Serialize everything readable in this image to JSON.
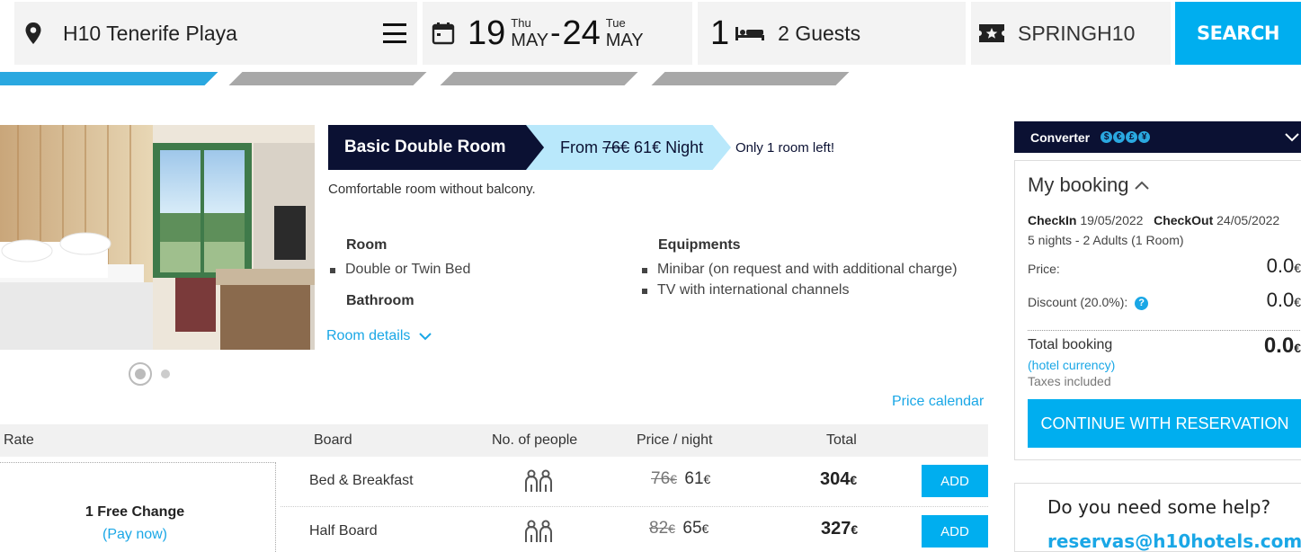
{
  "search_bar": {
    "hotel": "H10 Tenerife Playa",
    "checkin": {
      "day": "19",
      "weekday": "Thu",
      "month": "MAY"
    },
    "separator": "-",
    "checkout": {
      "day": "24",
      "weekday": "Tue",
      "month": "MAY"
    },
    "rooms": "1",
    "guests": "2 Guests",
    "promo_code": "SPRINGH10",
    "search_label": "SEARCH"
  },
  "steps": {
    "active_step": 1,
    "total_steps": 4
  },
  "room": {
    "title": "Basic Double Room",
    "price_prefix": "From",
    "old_price": "76€",
    "new_price": "61€",
    "price_suffix": "Night",
    "availability": "Only 1 room left!",
    "description": "Comfortable room without balcony.",
    "room_heading": "Room",
    "room_items": [
      "Double or Twin Bed"
    ],
    "bathroom_heading": "Bathroom",
    "equipment_heading": "Equipments",
    "equipment_items": [
      "Minibar (on request and with additional charge)",
      "TV with international channels"
    ],
    "details_link": "Room details",
    "photo_count": 2,
    "photo_active": 1
  },
  "price_calendar_link": "Price calendar",
  "rate_table": {
    "headers": {
      "rate": "Rate",
      "board": "Board",
      "people": "No. of people",
      "price": "Price / night",
      "total": "Total"
    },
    "rate_name": "1 Free Change",
    "rate_payment": "(Pay now)",
    "rows": [
      {
        "board": "Bed & Breakfast",
        "old_price": "76",
        "new_price": "61",
        "currency": "€",
        "total": "304",
        "add": "ADD"
      },
      {
        "board": "Half Board",
        "old_price": "82",
        "new_price": "65",
        "currency": "€",
        "total": "327",
        "add": "ADD"
      }
    ]
  },
  "converter": {
    "label": "Converter",
    "currencies": [
      "$",
      "€",
      "£",
      "¥"
    ]
  },
  "booking": {
    "title": "My booking",
    "checkin_label": "CheckIn",
    "checkin_date": "19/05/2022",
    "checkout_label": "CheckOut",
    "checkout_date": "24/05/2022",
    "summary": "5 nights - 2 Adults (1 Room)",
    "price_label": "Price:",
    "price_value": "0.0",
    "discount_label": "Discount (20.0%):",
    "discount_value": "0.0",
    "total_label": "Total booking",
    "total_value": "0.0",
    "currency": "€",
    "hotel_currency": "(hotel currency)",
    "taxes": "Taxes included",
    "continue_label": "CONTINUE WITH RESERVATION"
  },
  "help": {
    "title": "Do you need some help?",
    "email": "reservas@h10hotels.com"
  },
  "colors": {
    "accent": "#00aeef",
    "navy": "#0b1133",
    "light_blue": "#b9e8fb"
  }
}
